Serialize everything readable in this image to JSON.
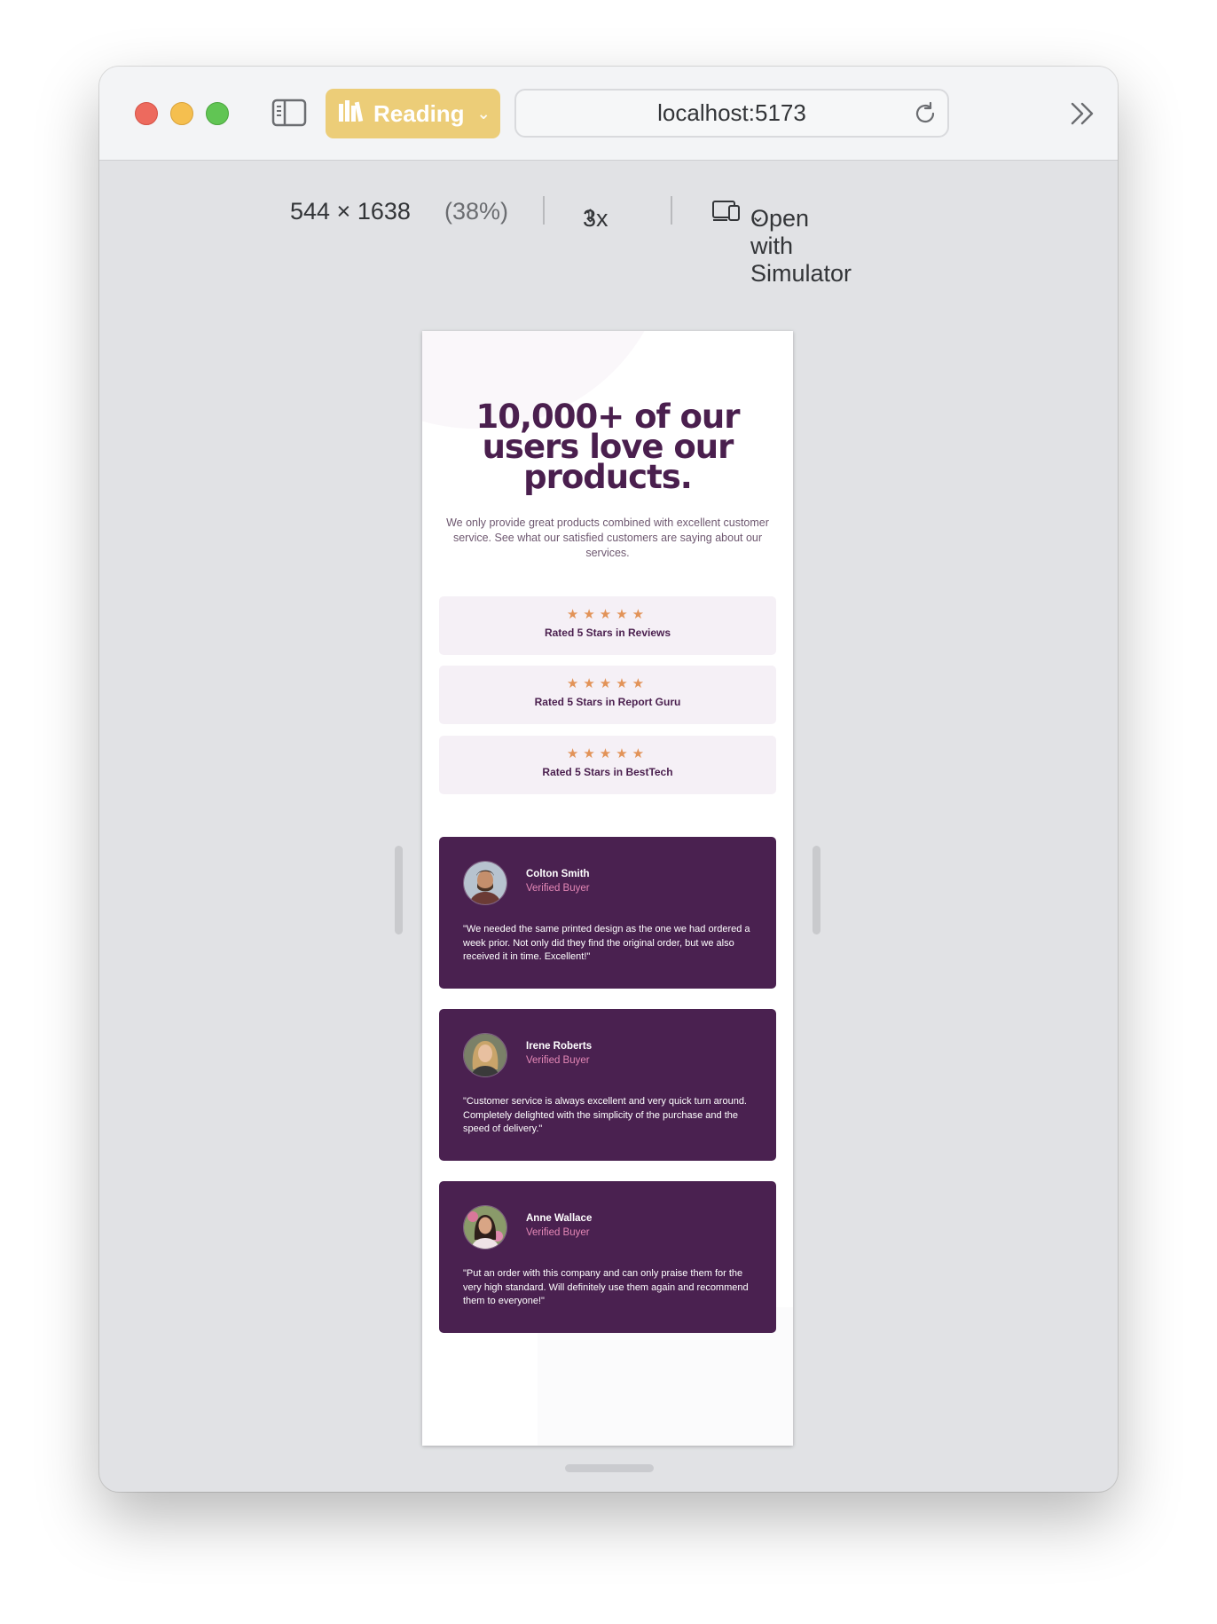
{
  "browser": {
    "reading_label": "Reading",
    "url": "localhost:5173"
  },
  "devtools": {
    "dimensions": "544 × 1638",
    "zoom": "(38%)",
    "scale": "3x",
    "simulator_label": "Open with Simulator"
  },
  "page": {
    "headline": "10,000+ of our users love our products.",
    "intro": "We only provide great products combined with excellent customer service. See what our satisfied customers are saying about our services.",
    "ratings": [
      {
        "stars": "★★★★★",
        "label": "Rated 5 Stars in Reviews"
      },
      {
        "stars": "★★★★★",
        "label": "Rated 5 Stars in Report Guru"
      },
      {
        "stars": "★★★★★",
        "label": "Rated 5 Stars in BestTech"
      }
    ],
    "reviews": [
      {
        "name": "Colton Smith",
        "badge": "Verified Buyer",
        "quote": "\"We needed the same printed design as the one we had ordered a week prior. Not only did they find the original order, but we also received it in time. Excellent!\""
      },
      {
        "name": "Irene Roberts",
        "badge": "Verified Buyer",
        "quote": "\"Customer service is always excellent and very quick turn around. Completely delighted with the simplicity of the purchase and the speed of delivery.\""
      },
      {
        "name": "Anne Wallace",
        "badge": "Verified Buyer",
        "quote": "\"Put an order with this company and can only praise them for the very high standard. Will definitely use them again and recommend them to everyone!\""
      }
    ]
  },
  "colors": {
    "primary_purple": "#4a2150",
    "light_pink_card": "#f5f0f6",
    "star_orange": "#e29358",
    "accent_pink": "#e387b5",
    "reading_yellow": "#eccd78"
  }
}
